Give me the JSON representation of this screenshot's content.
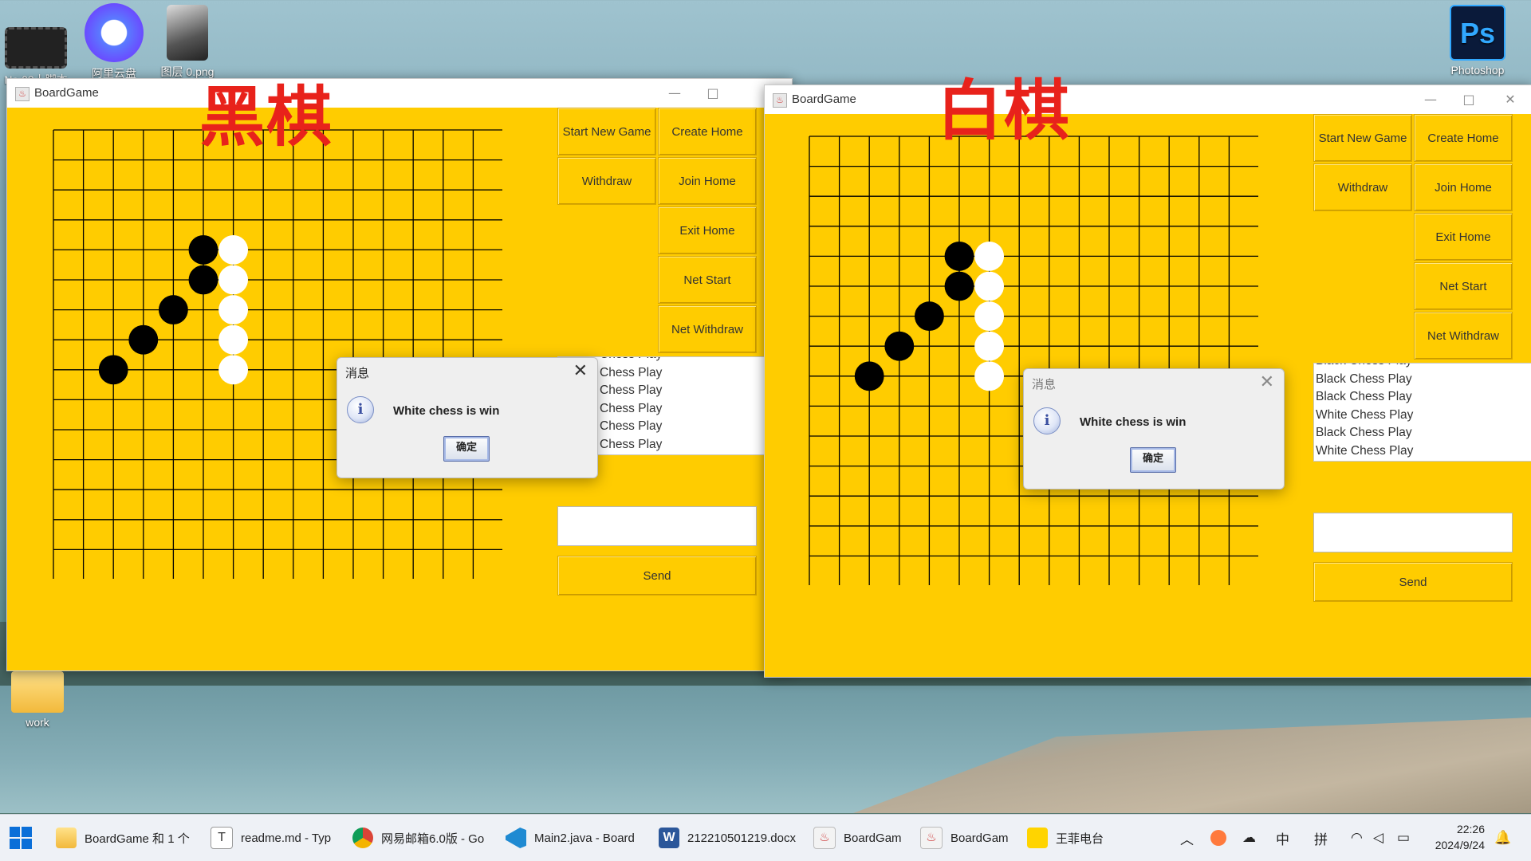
{
  "desktop": {
    "icons": [
      {
        "label": "No.03丨脚本"
      },
      {
        "label": "阿里云盘"
      },
      {
        "label": "图层 0.png"
      },
      {
        "label": "Photoshop"
      },
      {
        "label": "work"
      }
    ]
  },
  "annotations": {
    "black_label": "黑棋",
    "white_label": "白棋"
  },
  "windows": [
    {
      "title": "BoardGame",
      "buttons": {
        "start_new_game": "Start New Game",
        "create_home": "Create Home",
        "withdraw": "Withdraw",
        "join_home": "Join Home",
        "exit_home": "Exit Home",
        "net_start": "Net Start",
        "net_withdraw": "Net Withdraw",
        "send": "Send"
      },
      "log": [
        "Chess Play",
        "Chess Play",
        "Chess Play",
        "Chess Play",
        "Chess Play",
        "Chess Play"
      ],
      "message_input": {
        "value": ""
      },
      "dialog": {
        "title": "消息",
        "message": "White chess is win",
        "ok_label": "确定"
      }
    },
    {
      "title": "BoardGame",
      "buttons": {
        "start_new_game": "Start New Game",
        "create_home": "Create Home",
        "withdraw": "Withdraw",
        "join_home": "Join Home",
        "exit_home": "Exit Home",
        "net_start": "Net Start",
        "net_withdraw": "Net Withdraw",
        "send": "Send"
      },
      "log": [
        "Black Chess Play",
        "Black Chess Play",
        "Black Chess Play",
        "White Chess Play",
        "Black Chess Play",
        "White Chess Play"
      ],
      "message_input": {
        "value": ""
      },
      "dialog": {
        "title": "消息",
        "message": "White chess is win",
        "ok_label": "确定"
      }
    }
  ],
  "board": {
    "size": 15,
    "stones": {
      "black": [
        [
          5,
          4
        ],
        [
          5,
          5
        ],
        [
          4,
          6
        ],
        [
          3,
          7
        ],
        [
          2,
          8
        ]
      ],
      "white": [
        [
          6,
          4
        ],
        [
          6,
          5
        ],
        [
          6,
          6
        ],
        [
          6,
          7
        ],
        [
          6,
          8
        ]
      ]
    }
  },
  "taskbar": {
    "items": [
      {
        "label": "BoardGame 和 1 个"
      },
      {
        "label": "readme.md - Typ"
      },
      {
        "label": "网易邮箱6.0版 - Go"
      },
      {
        "label": "Main2.java - Board"
      },
      {
        "label": "212210501219.docx"
      },
      {
        "label": "BoardGam"
      },
      {
        "label": "BoardGam"
      },
      {
        "label": "王菲电台"
      }
    ],
    "tray": {
      "ime_lang": "中",
      "ime_mode": "拼"
    },
    "clock": {
      "time": "22:26",
      "date": "2024/9/24"
    }
  },
  "colors": {
    "client_bg": "#ffcc00",
    "annotation": "#e8221b",
    "stone_black": "#000000",
    "stone_white": "#ffffff"
  }
}
